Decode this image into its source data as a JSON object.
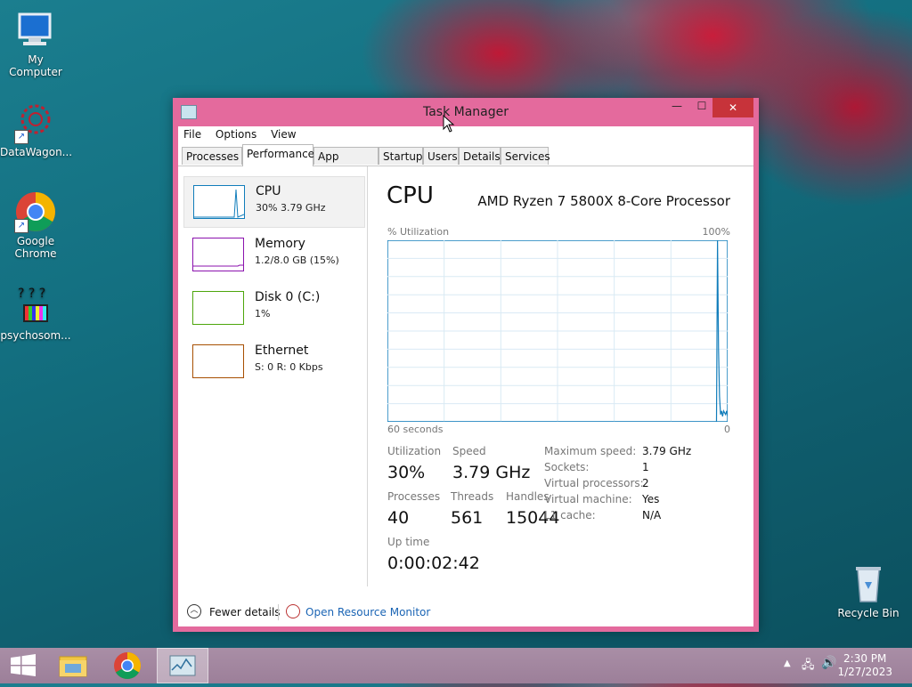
{
  "desktop": {
    "icons": [
      {
        "label": "My Computer",
        "icon": "computer-icon"
      },
      {
        "label": "DataWagon...",
        "icon": "datawagon-icon"
      },
      {
        "label": "Google Chrome",
        "icon": "chrome-icon"
      },
      {
        "label": "psychosom...",
        "icon": "psychosom-icon"
      },
      {
        "label": "Recycle Bin",
        "icon": "recycle-bin-icon"
      }
    ]
  },
  "window": {
    "title": "Task Manager",
    "controls": {
      "minimize": "—",
      "maximize": "☐",
      "close": "✕"
    },
    "menu": [
      "File",
      "Options",
      "View"
    ],
    "tabs": [
      "Processes",
      "Performance",
      "App history",
      "Startup",
      "Users",
      "Details",
      "Services"
    ],
    "active_tab": "Performance",
    "resources": [
      {
        "name": "CPU",
        "detail": "30%  3.79 GHz",
        "color": "#117dbb"
      },
      {
        "name": "Memory",
        "detail": "1.2/8.0 GB (15%)",
        "color": "#8b12ae"
      },
      {
        "name": "Disk 0 (C:)",
        "detail": "1%",
        "color": "#4da60c"
      },
      {
        "name": "Ethernet",
        "detail": "S: 0  R: 0 Kbps",
        "color": "#a74f01"
      }
    ],
    "cpu": {
      "heading": "CPU",
      "model": "AMD Ryzen 7 5800X 8-Core Processor",
      "graph_label_left": "% Utilization",
      "graph_label_right": "100%",
      "graph_time_left": "60 seconds",
      "graph_time_right": "0",
      "utilization_history": [
        0,
        0,
        0,
        0,
        0,
        0,
        0,
        0,
        0,
        0,
        0,
        0,
        0,
        0,
        0,
        0,
        0,
        0,
        0,
        0,
        0,
        0,
        0,
        0,
        0,
        0,
        0,
        0,
        0,
        0,
        0,
        0,
        0,
        0,
        0,
        0,
        0,
        0,
        0,
        0,
        0,
        0,
        0,
        0,
        0,
        0,
        0,
        0,
        0,
        0,
        0,
        0,
        0,
        0,
        0,
        0,
        0,
        0,
        0,
        0,
        0,
        0,
        0,
        0,
        0,
        0,
        0,
        0,
        0,
        0,
        0,
        0,
        0,
        0,
        0,
        0,
        0,
        0,
        0,
        0,
        0,
        0,
        0,
        0,
        0,
        0,
        0,
        0,
        0,
        0,
        0,
        0,
        0,
        0,
        0,
        0,
        0,
        0,
        0,
        0,
        0,
        0,
        0,
        0,
        0,
        0,
        0,
        0,
        0,
        0,
        0,
        0,
        0,
        0,
        0,
        0,
        0,
        0,
        0,
        0,
        0,
        0,
        0,
        0,
        0,
        0,
        0,
        0,
        0,
        0,
        0,
        0,
        0,
        0,
        0,
        0,
        0,
        0,
        0,
        0,
        0,
        0,
        0,
        0,
        0,
        0,
        0,
        0,
        0,
        0,
        0,
        0,
        0,
        0,
        0,
        0,
        0,
        0,
        0,
        0,
        0,
        0,
        0,
        0,
        0,
        0,
        0,
        0,
        0,
        0,
        0,
        0,
        0,
        0,
        0,
        0,
        0,
        0,
        0,
        0,
        0,
        0,
        0,
        0,
        0,
        0,
        0,
        0,
        0,
        0,
        0,
        0,
        0,
        0,
        0,
        0,
        0,
        0,
        0,
        0,
        0,
        0,
        0,
        0,
        0,
        0,
        0,
        0,
        0,
        0,
        0,
        0,
        0,
        0,
        0,
        0,
        0,
        0,
        0,
        0,
        0,
        0,
        0,
        0,
        0,
        0,
        0,
        0,
        0,
        0,
        0,
        0,
        0,
        0,
        0,
        0,
        0,
        0,
        0,
        0,
        0,
        0,
        0,
        0,
        0,
        0,
        0,
        0,
        0,
        0,
        0,
        0,
        0,
        0,
        0,
        0,
        0,
        0,
        0,
        0,
        0,
        0,
        0,
        0,
        0,
        0,
        0,
        0,
        0,
        0,
        0,
        0,
        0,
        0,
        0,
        0,
        0,
        0,
        0,
        0,
        0,
        0,
        0,
        0,
        0,
        0,
        0,
        0,
        0,
        0,
        0,
        0,
        0,
        0,
        0,
        0,
        0,
        0,
        0,
        0,
        0,
        0,
        0,
        0,
        0,
        0,
        0,
        0,
        0,
        0,
        0,
        0,
        0,
        0,
        0,
        0,
        0,
        0,
        0,
        0,
        0,
        0,
        0,
        0,
        0,
        0,
        100,
        40,
        14,
        4,
        6,
        3,
        6,
        5,
        4,
        6,
        3
      ],
      "stats": {
        "utilization_label": "Utilization",
        "utilization": "30%",
        "speed_label": "Speed",
        "speed": "3.79 GHz",
        "processes_label": "Processes",
        "processes": "40",
        "threads_label": "Threads",
        "threads": "561",
        "handles_label": "Handles",
        "handles": "15044",
        "uptime_label": "Up time",
        "uptime": "0:00:02:42"
      },
      "details": [
        {
          "label": "Maximum speed:",
          "value": "3.79 GHz"
        },
        {
          "label": "Sockets:",
          "value": "1"
        },
        {
          "label": "Virtual processors:",
          "value": "2"
        },
        {
          "label": "Virtual machine:",
          "value": "Yes"
        },
        {
          "label": "L1 cache:",
          "value": "N/A"
        }
      ]
    },
    "footer": {
      "fewer_details": "Fewer details",
      "open_monitor": "Open Resource Monitor"
    }
  },
  "taskbar": {
    "buttons": [
      "start-button",
      "file-explorer",
      "chrome",
      "task-manager"
    ],
    "clock_time": "2:30 PM",
    "clock_date": "1/27/2023"
  },
  "colors": {
    "accent": "#e46a9d",
    "graph_line": "#117dbb",
    "graph_grid": "#d9eaf4"
  }
}
